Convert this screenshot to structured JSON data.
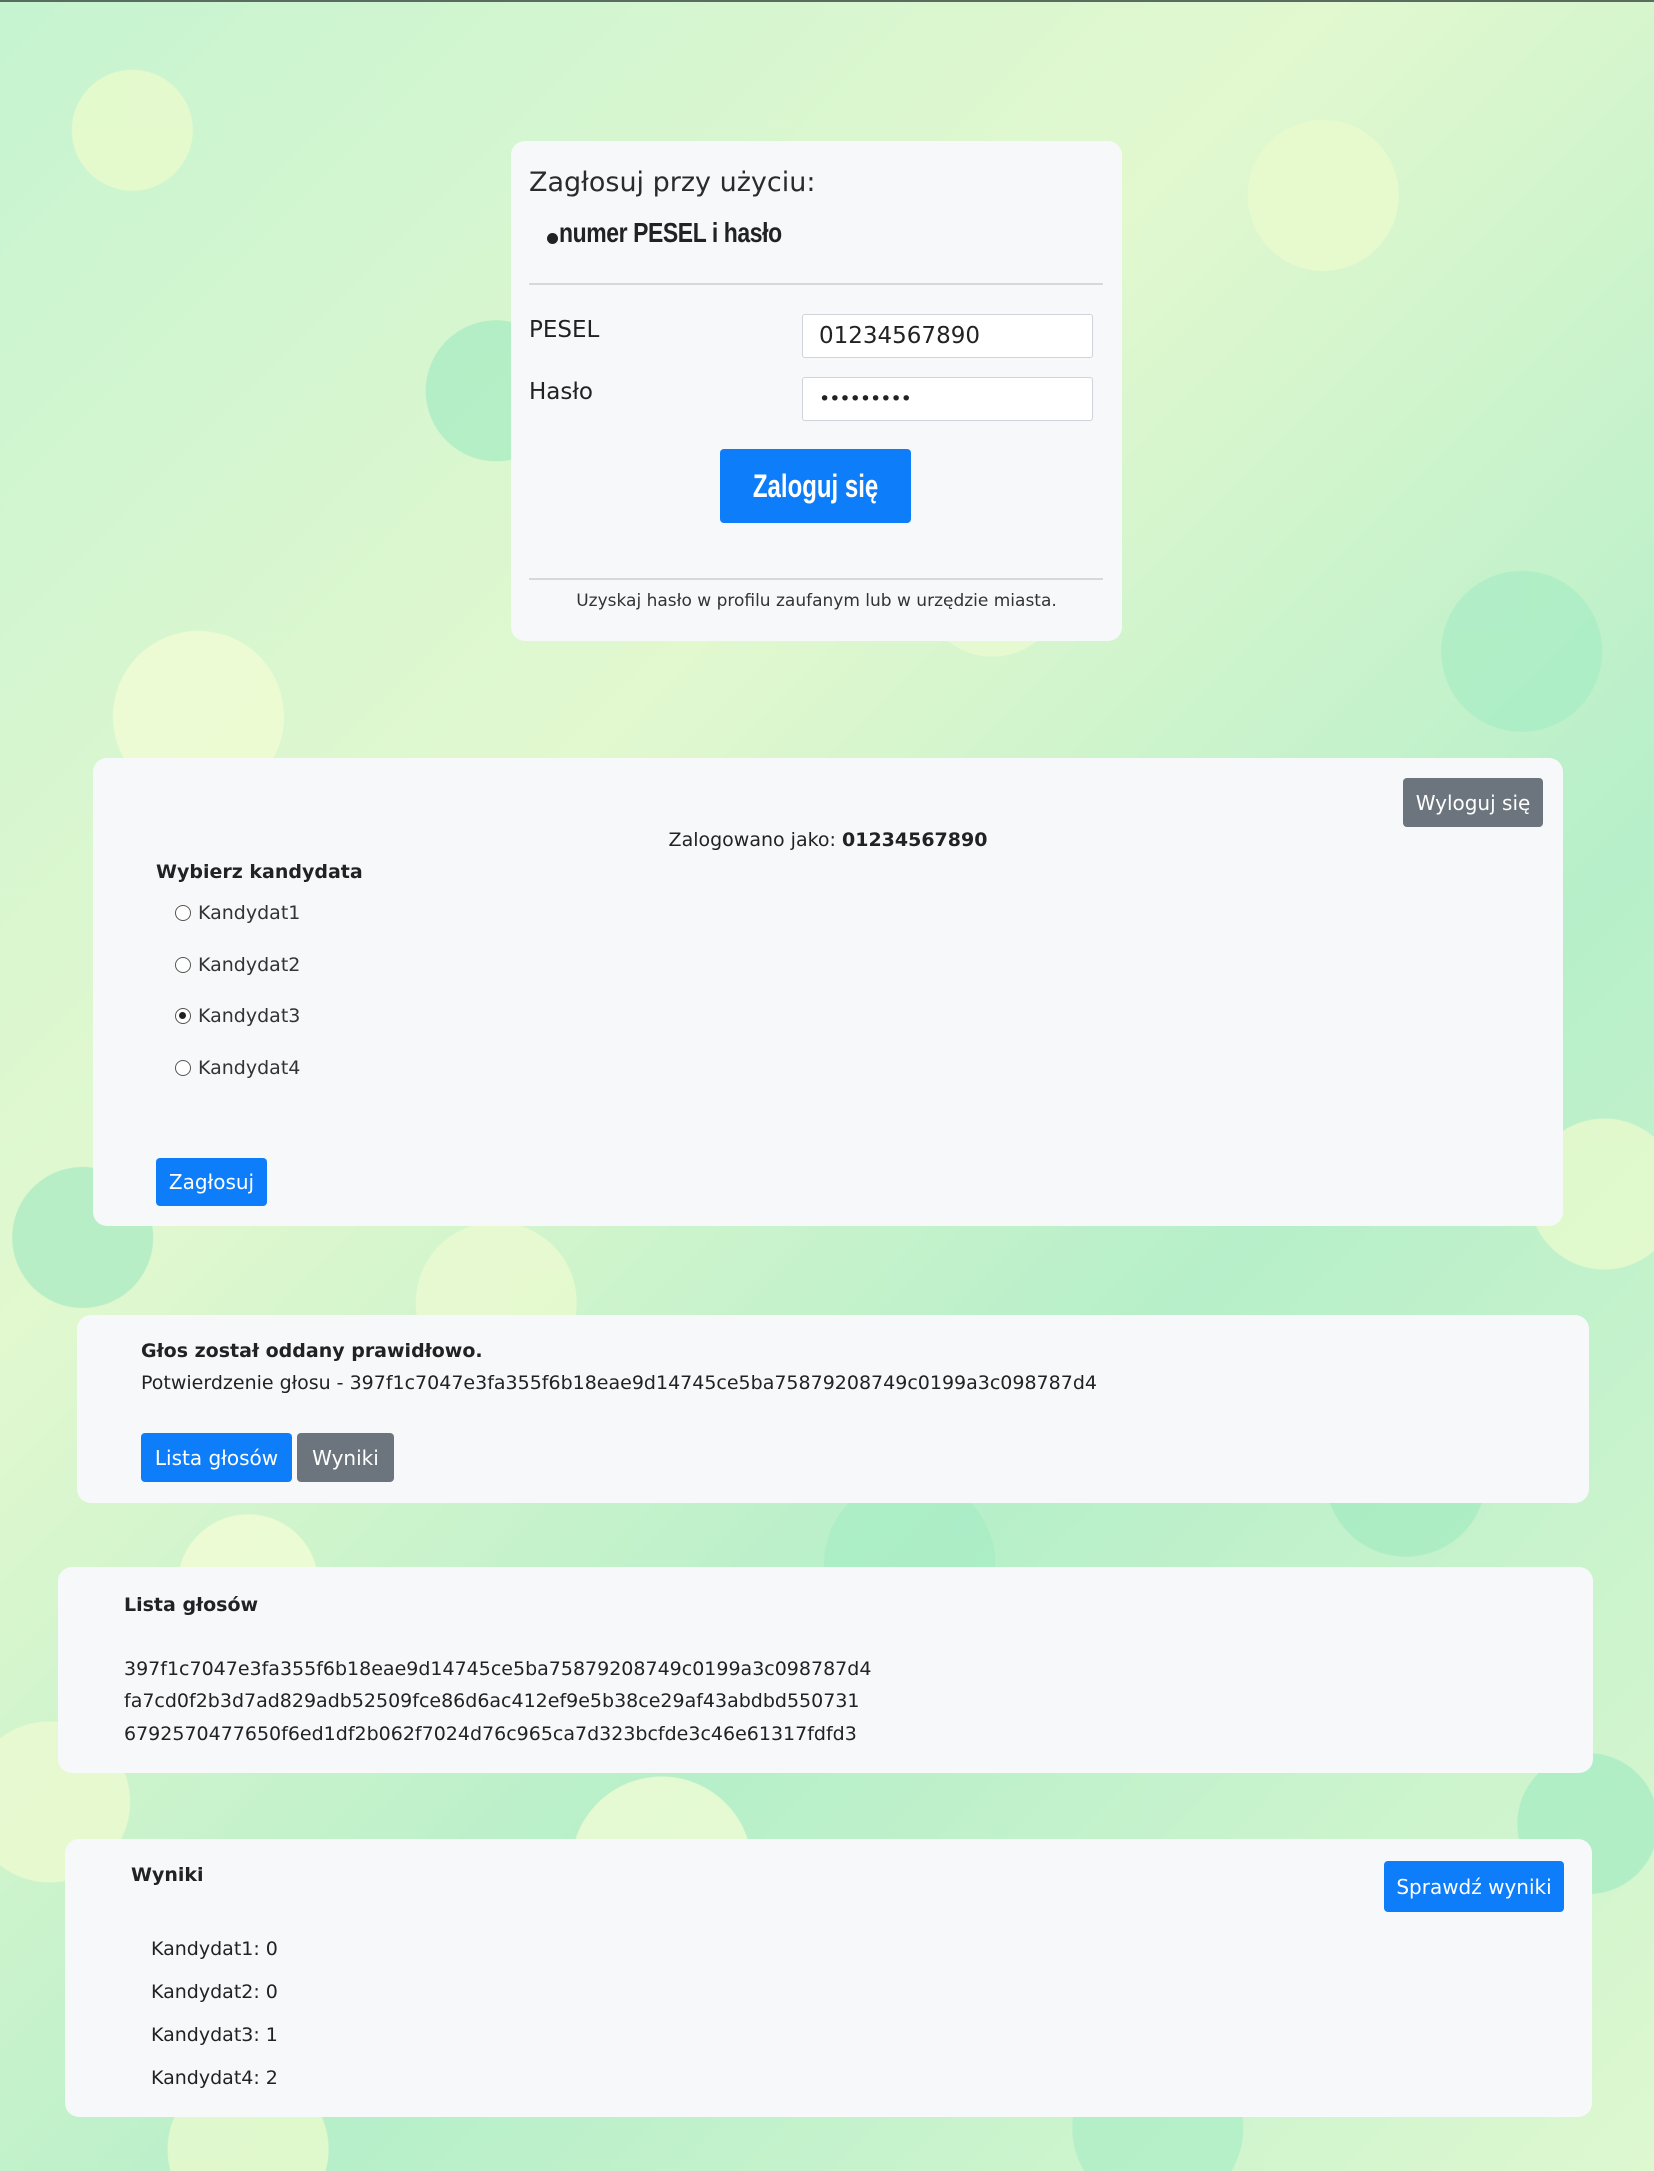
{
  "login": {
    "title": "Zagłosuj przy użyciu:",
    "method": "numer PESEL i hasło",
    "pesel_label": "PESEL",
    "pesel_value": "01234567890",
    "password_label": "Hasło",
    "password_value": "•••••••••",
    "login_button": "Zaloguj się",
    "footer": "Uzyskaj hasło w profilu zaufanym lub w urzędzie miasta."
  },
  "vote": {
    "logout_button": "Wyloguj się",
    "logged_as_label": "Zalogowano jako:",
    "logged_as_value": "01234567890",
    "choose_title": "Wybierz kandydata",
    "candidates": [
      {
        "label": "Kandydat1",
        "checked": false
      },
      {
        "label": "Kandydat2",
        "checked": false
      },
      {
        "label": "Kandydat3",
        "checked": true
      },
      {
        "label": "Kandydat4",
        "checked": false
      }
    ],
    "vote_button": "Zagłosuj"
  },
  "confirmation": {
    "title": "Głos został oddany prawidłowo.",
    "detail": "Potwierdzenie głosu - 397f1c7047e3fa355f6b18eae9d14745ce5ba75879208749c0199a3c098787d4",
    "list_button": "Lista głosów",
    "results_button": "Wyniki"
  },
  "vote_list": {
    "title": "Lista głosów",
    "items": [
      "397f1c7047e3fa355f6b18eae9d14745ce5ba75879208749c0199a3c098787d4",
      "fa7cd0f2b3d7ad829adb52509fce86d6ac412ef9e5b38ce29af43abdbd550731",
      "6792570477650f6ed1df2b062f7024d76c965ca7d323bcfde3c46e61317fdfd3"
    ]
  },
  "results": {
    "title": "Wyniki",
    "check_button": "Sprawdź wyniki",
    "items": [
      "Kandydat1: 0",
      "Kandydat2: 0",
      "Kandydat3: 1",
      "Kandydat4: 2"
    ]
  },
  "colors": {
    "primary": "#0d7dfa",
    "secondary": "#6c757d",
    "card": "#f7f8fa"
  }
}
